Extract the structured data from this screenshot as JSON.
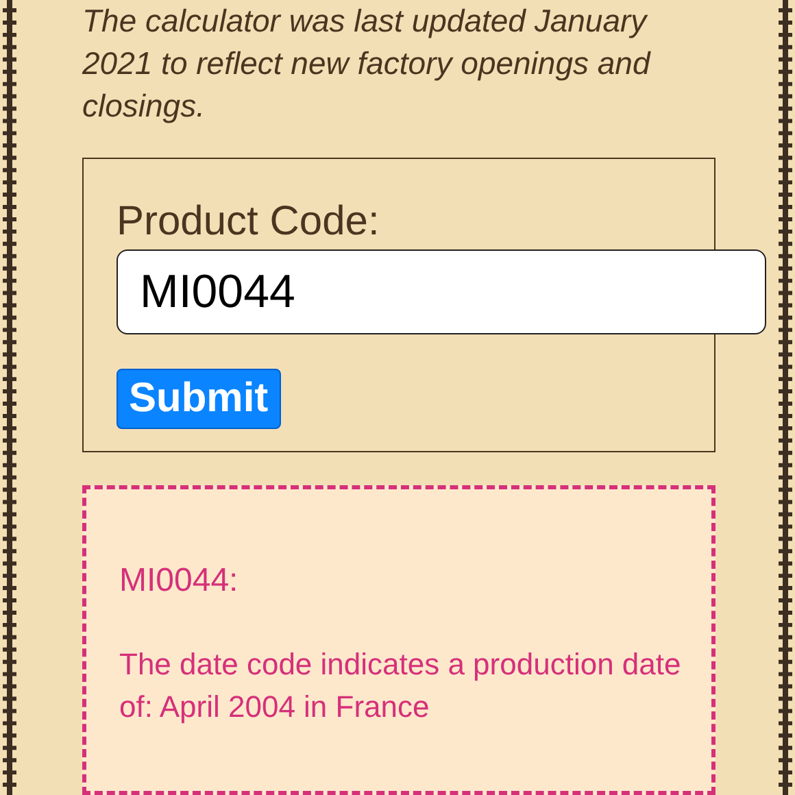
{
  "intro": "The calculator was last updated January 2021 to reflect new factory openings and closings.",
  "form": {
    "label": "Product Code:",
    "value": "MI0044",
    "button": "Submit"
  },
  "result": {
    "title": "MI0044:",
    "text": "The date code indicates a production date of: April 2004 in France"
  }
}
